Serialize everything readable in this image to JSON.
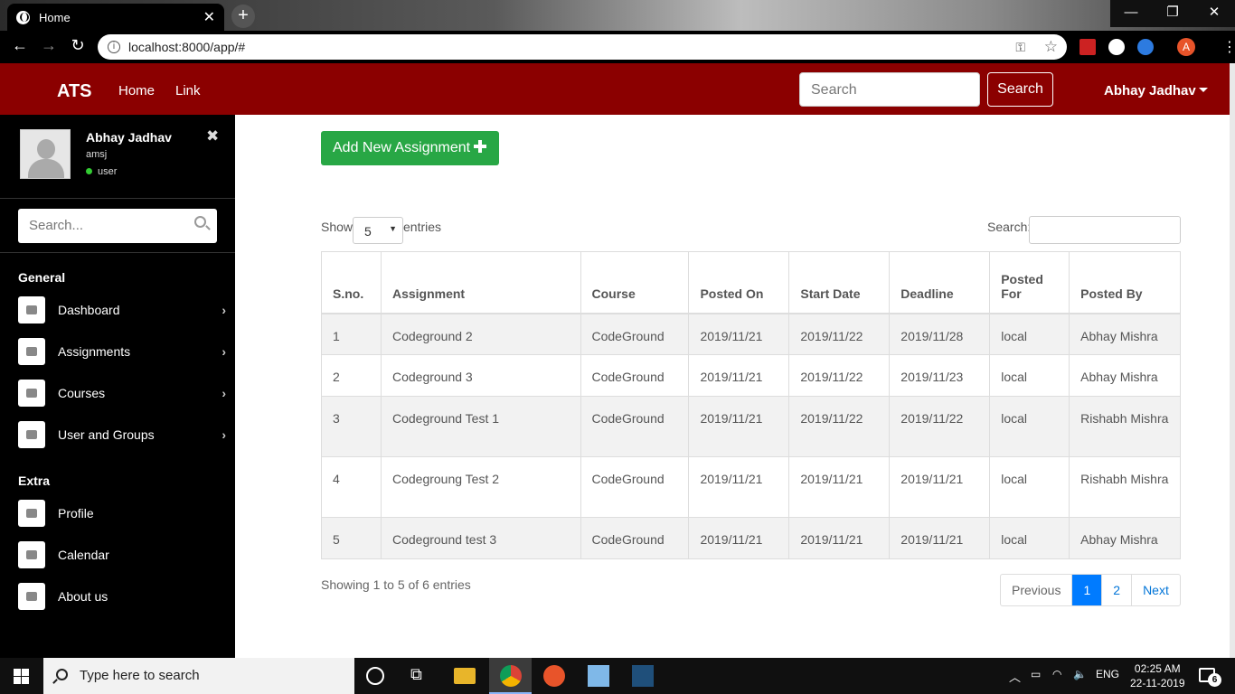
{
  "browser": {
    "tab_title": "Home",
    "url": "localhost:8000/app/#",
    "profile_initial": "A"
  },
  "navbar": {
    "brand": "ATS",
    "links": [
      "Home",
      "Link"
    ],
    "search_placeholder": "Search",
    "search_button": "Search",
    "user": "Abhay Jadhav",
    "color": "#8b0000"
  },
  "sidebar": {
    "name": "Abhay Jadhav",
    "username": "amsj",
    "role": "user",
    "search_placeholder": "Search...",
    "general_heading": "General",
    "general_items": [
      {
        "label": "Dashboard",
        "icon": "dashboard-icon"
      },
      {
        "label": "Assignments",
        "icon": "list-icon"
      },
      {
        "label": "Courses",
        "icon": "courses-icon"
      },
      {
        "label": "User and Groups",
        "icon": "users-icon"
      }
    ],
    "extra_heading": "Extra",
    "extra_items": [
      {
        "label": "Profile",
        "icon": "profile-icon"
      },
      {
        "label": "Calendar",
        "icon": "calendar-icon"
      },
      {
        "label": "About us",
        "icon": "info-icon"
      }
    ]
  },
  "main": {
    "add_button": "Add New Assignment",
    "show_label": "Show",
    "entries_value": "5",
    "entries_label": "entries",
    "search_label": "Search:",
    "columns": [
      "S.no.",
      "Assignment",
      "Course",
      "Posted On",
      "Start Date",
      "Deadline",
      "Posted For",
      "Posted By"
    ],
    "rows": [
      [
        "1",
        "Codeground 2",
        "CodeGround",
        "2019/11/21",
        "2019/11/22",
        "2019/11/28",
        "local",
        "Abhay Mishra"
      ],
      [
        "2",
        "Codeground 3",
        "CodeGround",
        "2019/11/21",
        "2019/11/22",
        "2019/11/23",
        "local",
        "Abhay Mishra"
      ],
      [
        "3",
        "Codeground Test 1",
        "CodeGround",
        "2019/11/21",
        "2019/11/22",
        "2019/11/22",
        "local",
        "Rishabh Mishra"
      ],
      [
        "4",
        "Codegroung Test 2",
        "CodeGround",
        "2019/11/21",
        "2019/11/21",
        "2019/11/21",
        "local",
        "Rishabh Mishra"
      ],
      [
        "5",
        "Codeground test 3",
        "CodeGround",
        "2019/11/21",
        "2019/11/21",
        "2019/11/21",
        "local",
        "Abhay Mishra"
      ]
    ],
    "info": "Showing 1 to 5 of 6 entries",
    "pagination": [
      "Previous",
      "1",
      "2",
      "Next"
    ],
    "active_page": "1",
    "add_button_color": "#28a745"
  },
  "taskbar": {
    "search_placeholder": "Type here to search",
    "language": "ENG",
    "time": "02:25 AM",
    "date": "22-11-2019",
    "notifications": "6"
  }
}
